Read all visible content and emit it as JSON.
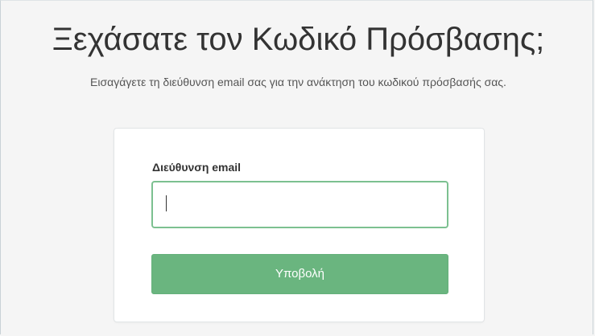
{
  "page": {
    "title": "Ξεχάσατε τον Κωδικό Πρόσβασης;",
    "subtitle": "Εισαγάγετε τη διεύθυνση email σας για την ανάκτηση του κωδικού πρόσβασής σας."
  },
  "form": {
    "email_label": "Διεύθυνση email",
    "email_value": "",
    "submit_label": "Υποβολή"
  },
  "colors": {
    "accent": "#6ab57f",
    "input_focus_border": "#7cc090",
    "background": "#f5f5f5"
  }
}
